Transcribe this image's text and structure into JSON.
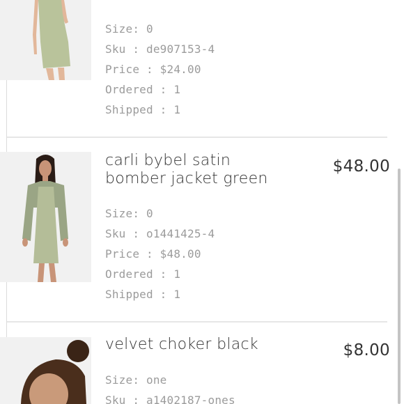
{
  "order_items": [
    {
      "title": "",
      "price": "",
      "image_alt": "green bodycon dress",
      "details": {
        "size": "Size: 0",
        "sku": "Sku : de907153-4",
        "price": "Price : $24.00",
        "ordered": "Ordered : 1",
        "shipped": "Shipped : 1"
      }
    },
    {
      "title": "carli bybel satin bomber jacket green",
      "price": "$48.00",
      "image_alt": "satin bomber jacket green",
      "details": {
        "size": "Size: 0",
        "sku": "Sku : o1441425-4",
        "price": "Price : $48.00",
        "ordered": "Ordered : 1",
        "shipped": "Shipped : 1"
      }
    },
    {
      "title": "velvet choker black",
      "price": "$8.00",
      "image_alt": "velvet choker black",
      "details": {
        "size": "Size: one",
        "sku": "Sku : a1402187-ones"
      }
    }
  ],
  "colors": {
    "text_primary": "#333333",
    "text_secondary": "#9b9b9b",
    "divider": "#e6e6e6",
    "product_green": "#b9c39b"
  }
}
